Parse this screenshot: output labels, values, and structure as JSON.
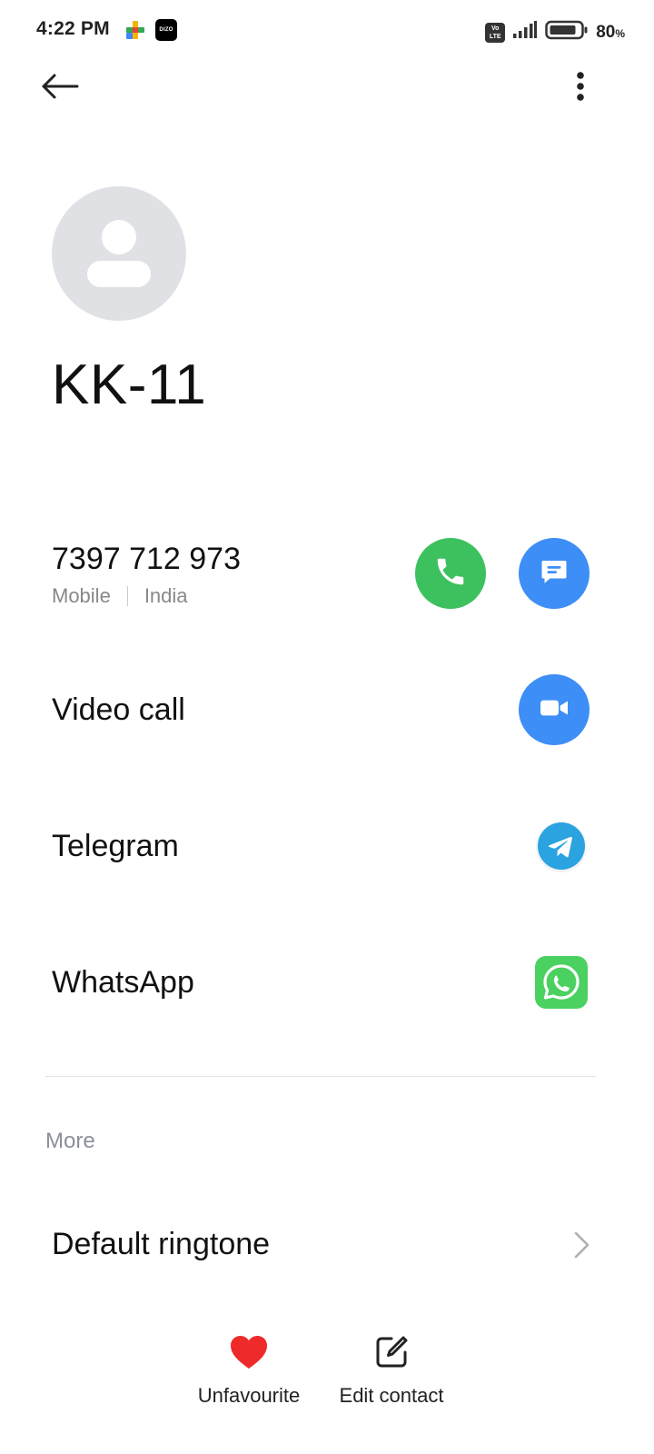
{
  "status_bar": {
    "time": "4:22 PM",
    "app_icon_2_text": "DIZO",
    "volte_top": "Vo",
    "volte_bottom": "LTE",
    "battery_level": "80",
    "battery_unit": "%"
  },
  "top_bar": {
    "back_icon": "arrow-left-icon",
    "more_icon": "more-vertical-icon"
  },
  "contact": {
    "name": "KK-11",
    "avatar_icon": "person-icon",
    "phone": {
      "number": "7397 712 973",
      "type": "Mobile",
      "region": "India"
    }
  },
  "actions": {
    "video_call_label": "Video call",
    "telegram_label": "Telegram",
    "whatsapp_label": "WhatsApp"
  },
  "more_section": {
    "title": "More",
    "ringtone_label": "Default ringtone"
  },
  "bottom_bar": {
    "unfavourite_label": "Unfavourite",
    "edit_label": "Edit contact"
  },
  "colors": {
    "call_green": "#3dc15f",
    "action_blue": "#3d8ef6",
    "telegram_blue": "#2aa3e0",
    "whatsapp_green": "#4ad15f",
    "heart_red": "#ee2a2a",
    "avatar_bg": "#dfe1e5"
  }
}
